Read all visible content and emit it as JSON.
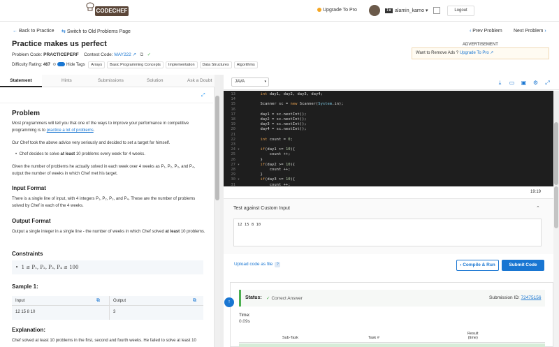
{
  "brand": {
    "logo_text": "CODECHEF"
  },
  "topbar": {
    "upgrade": "Upgrade To Pro",
    "rating_badge": "1★",
    "username": "alamin_karno",
    "logout": "Logout"
  },
  "nav": {
    "back": "Back to Practice",
    "switch": "Switch to Old Problems Page",
    "prev": "Prev Problem",
    "next": "Next Problem"
  },
  "problem": {
    "title": "Practice makes us perfect",
    "code_label": "Problem Code:",
    "code": "PRACTICEPERF",
    "contest_label": "Contest Code:",
    "contest": "MAY222",
    "difficulty_label": "Difficulty Rating:",
    "difficulty": "467",
    "hide_tags": "Hide Tags",
    "tags": [
      "Arrays",
      "Basic Programming Concepts",
      "Implementation",
      "Data Structures",
      "Algorithms"
    ]
  },
  "ad": {
    "label": "ADVERTISEMENT",
    "text": "Want to Remove Ads ?",
    "link": "Upgrade To Pro"
  },
  "tabs": [
    "Statement",
    "Hints",
    "Submissions",
    "Solution",
    "Ask a Doubt"
  ],
  "statement": {
    "heading": "Problem",
    "p1a": "Most programmers will tell you that one of the ways to improve your performance in competitive programming is to ",
    "p1link": "practice a lot of problems",
    "p1b": ".",
    "p2": "Our Chef took the above advice very seriously and decided to set a target for himself.",
    "bullet_a": "Chef decides to solve ",
    "bullet_b": "at least",
    "bullet_c": " 10 problems every week for 4 weeks.",
    "p3": "Given the number of problems he actually solved in each week over 4 weeks as P₁, P₂, P₃, and P₄, output the number of weeks in which Chef met his target.",
    "input_heading": "Input Format",
    "input_text": "There is a single line of input, with 4 integers P₁, P₂, P₃, and P₄. These are the number of problems solved by Chef in each of the 4 weeks.",
    "output_heading": "Output Format",
    "output_text_a": "Output a single integer in a single line - the number of weeks in which Chef solved ",
    "output_text_b": "at least",
    "output_text_c": " 10 problems.",
    "constraints_heading": "Constraints",
    "constraint": "1 ≤ P₁, P₂, P₃, P₄ ≤ 100",
    "sample_heading": "Sample 1:",
    "sample_input_label": "Input",
    "sample_output_label": "Output",
    "sample_input": "12 15 8 10",
    "sample_output": "3",
    "explanation_heading": "Explanation:",
    "explanation": "Chef solved at least 10 problems in the first, second and fourth weeks. He failed to solve at least 10"
  },
  "editor": {
    "language": "JAVA",
    "lines": [
      {
        "n": "13",
        "t": "        int day1, day2, day3, day4;"
      },
      {
        "n": "14",
        "t": ""
      },
      {
        "n": "15",
        "t": "        Scanner sc = new Scanner(System.in);"
      },
      {
        "n": "16",
        "t": ""
      },
      {
        "n": "17",
        "t": "        day1 = sc.nextInt();"
      },
      {
        "n": "18",
        "t": "        day2 = sc.nextInt();"
      },
      {
        "n": "19",
        "t": "        day3 = sc.nextInt();"
      },
      {
        "n": "20",
        "t": "        day4 = sc.nextInt();"
      },
      {
        "n": "21",
        "t": ""
      },
      {
        "n": "22",
        "t": "        int count = 0;"
      },
      {
        "n": "23",
        "t": ""
      },
      {
        "n": "24",
        "t": "        if(day1 >= 10){"
      },
      {
        "n": "25",
        "t": "            count ++;"
      },
      {
        "n": "26",
        "t": "        }"
      },
      {
        "n": "27",
        "t": "        if(day2 >= 10){"
      },
      {
        "n": "28",
        "t": "            count ++;"
      },
      {
        "n": "29",
        "t": "        }"
      },
      {
        "n": "30",
        "t": "        if(day3 >= 10){"
      },
      {
        "n": "31",
        "t": "            count ++;"
      }
    ],
    "cursor": "19:19"
  },
  "custom": {
    "title": "Test against Custom Input",
    "value": "12 15 8 10"
  },
  "actions": {
    "upload": "Upload code as file",
    "run": "Compile & Run",
    "submit": "Submit Code"
  },
  "result": {
    "status_label": "Status:",
    "status": "Correct Answer",
    "submission_label": "Submission ID:",
    "submission_id": "72475156",
    "time_label": "Time:",
    "time": "0.09s",
    "col_subtask": "Sub-Task",
    "col_task": "Task #",
    "col_result": "Result",
    "col_result_sub": "(time)"
  }
}
